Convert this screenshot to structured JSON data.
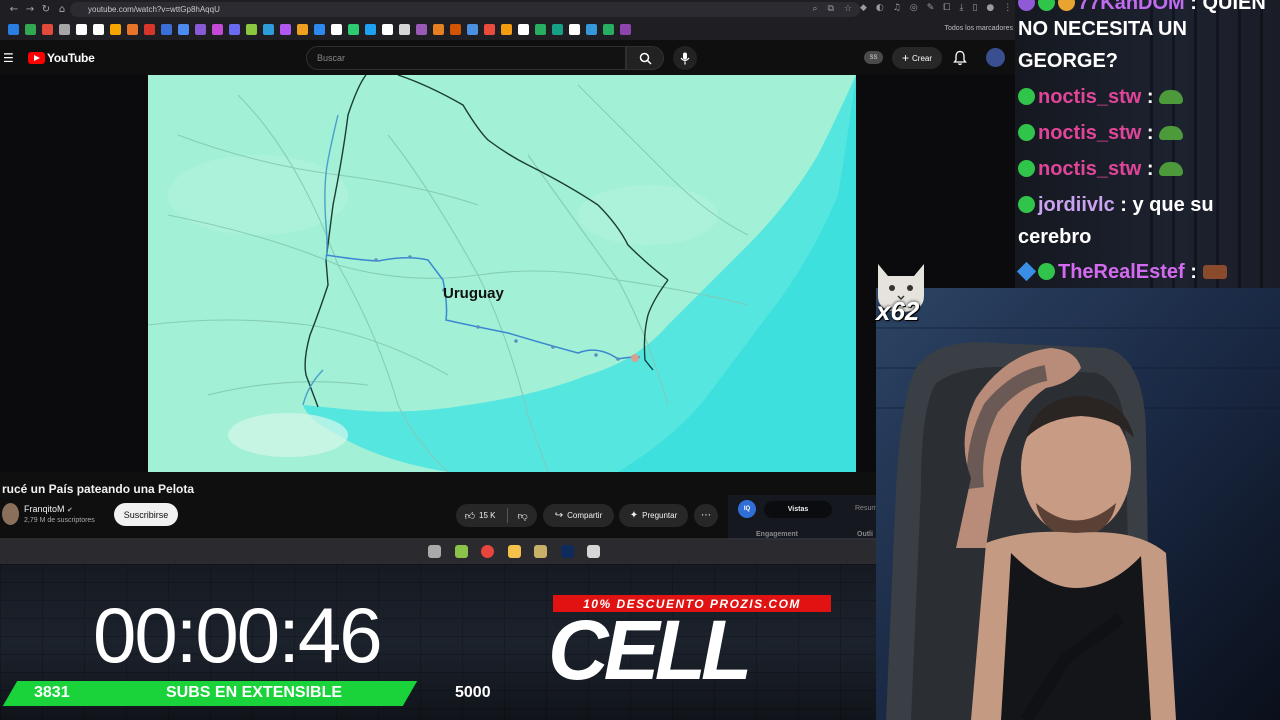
{
  "browser": {
    "url": "youtube.com/watch?v=wttGp8hAqqU",
    "bookmarks_all_label": "Todos los marcadores",
    "bookmark_colors": [
      "#2a7de1",
      "#33a853",
      "#e24a3b",
      "#a6a6a6",
      "#ffffff",
      "#ffffff",
      "#f7a600",
      "#e8742a",
      "#d9362b",
      "#3b6fd8",
      "#4d8af0",
      "#8a5ad6",
      "#c44ad6",
      "#6a6af0",
      "#8cc63f",
      "#2d9cdb",
      "#b058f0",
      "#f0a020",
      "#2d89ef",
      "#ffffff",
      "#2ecc71",
      "#1da1f2",
      "#ffffff",
      "#d5d5d5",
      "#9b59b6",
      "#e67e22",
      "#d35400",
      "#4a90e2",
      "#e74c3c",
      "#f39c12",
      "#ffffff",
      "#27ae60",
      "#16a085",
      "#ffffff",
      "#3498db",
      "#27ae60",
      "#8e44ad"
    ]
  },
  "youtube": {
    "logo_text": "YouTube",
    "search_placeholder": "Buscar",
    "ss_badge": "SS",
    "create_label": "Crear"
  },
  "video": {
    "map_label": "Uruguay",
    "title": "rucé un País pateando una Pelota",
    "channel_name": "FranqitoM",
    "subscribers": "2,79 M de suscriptores",
    "subscribe_label": "Suscribirse",
    "likes": "15 K",
    "share_label": "Compartir",
    "ask_label": "Preguntar"
  },
  "side_panel": {
    "icon_label": "IQ",
    "tab_active": "Vistas",
    "tab_other": "Resum",
    "label_engagement": "Engagement",
    "label_outliers": "Outli"
  },
  "taskbar": {
    "icon_colors": [
      "#aaaaaa",
      "#8bc34a",
      "#e8453c",
      "#f4c24b",
      "#c7b16a",
      "#0f2b5b",
      "#d6d6d6"
    ]
  },
  "overlay": {
    "timer": "00:00:46",
    "subs_current": "3831",
    "subs_label": "SUBS EN EXTENSIBLE",
    "subs_goal": "5000",
    "promo": "10% DESCUENTO PROZIS.COM",
    "sponsor_word": "CELL",
    "bar_color": "#1ad33b"
  },
  "chat": {
    "messages": [
      {
        "user": "77KanDOM",
        "text": "QUIEN"
      },
      {
        "text": "NO NECESITA UN"
      },
      {
        "text": "GEORGE?"
      },
      {
        "user": "noctis_stw",
        "text": ":"
      },
      {
        "user": "noctis_stw",
        "text": ":"
      },
      {
        "user": "noctis_stw",
        "text": ":"
      },
      {
        "user": "jordiivlc",
        "text": ": y que su"
      },
      {
        "text": "cerebro"
      },
      {
        "user": "TheRealEstef",
        "text": ":"
      }
    ]
  },
  "emote": {
    "count": "x62"
  }
}
